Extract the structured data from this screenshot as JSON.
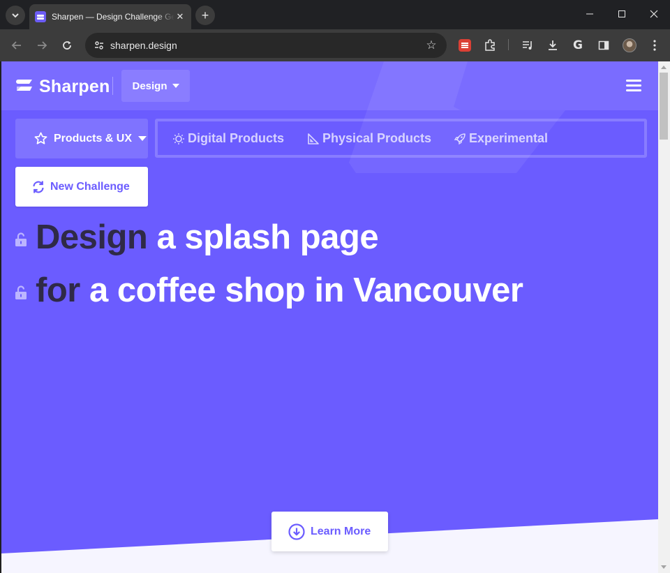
{
  "browser": {
    "tab_title": "Sharpen — Design Challenge Generator",
    "url": "sharpen.design",
    "icons": [
      "tab-search-icon",
      "new-tab-icon",
      "back-icon",
      "forward-icon",
      "reload-icon",
      "site-info-icon",
      "bookmark-star-icon",
      "todoist-extension-icon",
      "extensions-icon",
      "media-controls-icon",
      "download-icon",
      "google-icon",
      "side-panel-icon",
      "profile-avatar",
      "more-menu-icon"
    ],
    "window_controls": [
      "minimize",
      "maximize",
      "close"
    ]
  },
  "site": {
    "logo_text": "Sharpen",
    "discipline_dropdown": "Design",
    "categories": {
      "active": "Products & UX",
      "others": [
        "Digital Products",
        "Physical Products",
        "Experimental"
      ]
    },
    "new_challenge_label": "New Challenge",
    "headline": {
      "line1_verb": "Design",
      "line1_rest": "a splash page",
      "line2_verb": "for",
      "line2_rest": "a coffee shop in Vancouver"
    },
    "learn_more_label": "Learn More"
  },
  "colors": {
    "brand_purple": "#6b5cff",
    "headline_dark": "#2f2a47",
    "page_light": "#f6f5ff"
  }
}
